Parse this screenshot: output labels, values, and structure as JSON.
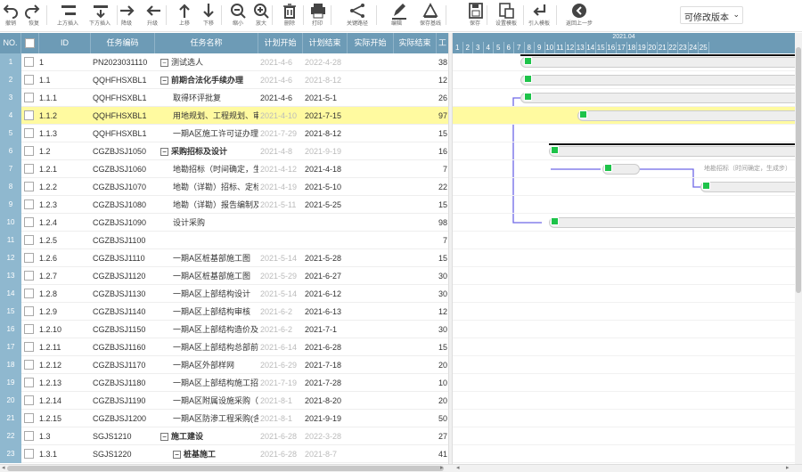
{
  "toolbar": {
    "items": [
      {
        "label": "撤销",
        "icon": "undo-icon"
      },
      {
        "label": "恢复",
        "icon": "redo-icon"
      },
      {
        "label": "上方插入",
        "icon": "insert-above-icon"
      },
      {
        "label": "下方插入",
        "icon": "insert-below-icon"
      },
      {
        "label": "降级",
        "icon": "demote-icon"
      },
      {
        "label": "升级",
        "icon": "promote-icon"
      },
      {
        "label": "上移",
        "icon": "move-up-icon"
      },
      {
        "label": "下移",
        "icon": "move-down-icon"
      },
      {
        "label": "缩小",
        "icon": "zoom-out-icon"
      },
      {
        "label": "放大",
        "icon": "zoom-in-icon"
      },
      {
        "label": "删除",
        "icon": "trash-icon"
      },
      {
        "label": "打印",
        "icon": "print-icon"
      },
      {
        "label": "关键路径",
        "icon": "critical-path-icon"
      },
      {
        "label": "编辑",
        "icon": "edit-icon"
      },
      {
        "label": "保存基线",
        "icon": "save-baseline-icon"
      },
      {
        "label": "保存",
        "icon": "save-icon"
      },
      {
        "label": "设置模板",
        "icon": "template-icon"
      },
      {
        "label": "引入模板",
        "icon": "import-icon"
      },
      {
        "label": "返回上一步",
        "icon": "back-icon"
      }
    ],
    "version_select": "可修改版本"
  },
  "grid": {
    "columns": {
      "no": "NO.",
      "id": "ID",
      "code": "任务编码",
      "name": "任务名称",
      "plan_start": "计划开始",
      "plan_end": "计划结束",
      "actual_start": "实际开始",
      "actual_end": "实际结束",
      "duration": "工"
    },
    "rows": [
      {
        "no": "1",
        "id": "1",
        "code": "PN2023031110",
        "name": "测试选人",
        "toggle": "−",
        "bold": false,
        "ps": "2021-4-6",
        "pe": "2022-4-28",
        "pe_grey": true,
        "ps_dark": false,
        "d": "38"
      },
      {
        "no": "2",
        "id": "1.1",
        "code": "QQHFHSXBL1",
        "name": "前期合法化手续办理",
        "toggle": "−",
        "bold": true,
        "ps": "2021-4-6",
        "pe": "2021-8-12",
        "pe_grey": true,
        "ps_dark": false,
        "d": "12"
      },
      {
        "no": "3",
        "id": "1.1.1",
        "code": "QQHFHSXBL1",
        "name": "取得环评批复",
        "toggle": "",
        "bold": false,
        "ps": "2021-4-6",
        "pe": "2021-5-1",
        "pe_grey": false,
        "ps_dark": true,
        "d": "26"
      },
      {
        "no": "4",
        "id": "1.1.2",
        "code": "QQHFHSXBL1",
        "name": "用地规划、工程规划、审",
        "toggle": "",
        "bold": false,
        "ps": "2021-4-10",
        "pe": "2021-7-15",
        "pe_grey": false,
        "ps_dark": false,
        "d": "97",
        "hl": true
      },
      {
        "no": "5",
        "id": "1.1.3",
        "code": "QQHFHSXBL1",
        "name": "一期A区施工许可证办理",
        "toggle": "",
        "bold": false,
        "ps": "2021-7-29",
        "pe": "2021-8-12",
        "pe_grey": false,
        "ps_dark": false,
        "d": "15"
      },
      {
        "no": "6",
        "id": "1.2",
        "code": "CGZBJSJ1050",
        "name": "采购招标及设计",
        "toggle": "−",
        "bold": true,
        "ps": "2021-4-8",
        "pe": "2021-9-19",
        "pe_grey": true,
        "ps_dark": false,
        "d": "16"
      },
      {
        "no": "7",
        "id": "1.2.1",
        "code": "CGZBJSJ1060",
        "name": "地勘招标（时间确定，生",
        "toggle": "",
        "bold": false,
        "ps": "2021-4-12",
        "pe": "2021-4-18",
        "pe_grey": false,
        "ps_dark": false,
        "d": "7"
      },
      {
        "no": "8",
        "id": "1.2.2",
        "code": "CGZBJSJ1070",
        "name": "地勘（详勘）招标、定标",
        "toggle": "",
        "bold": false,
        "ps": "2021-4-19",
        "pe": "2021-5-10",
        "pe_grey": false,
        "ps_dark": false,
        "d": "22"
      },
      {
        "no": "9",
        "id": "1.2.3",
        "code": "CGZBJSJ1080",
        "name": "地勘（详勘）报告编制及",
        "toggle": "",
        "bold": false,
        "ps": "2021-5-11",
        "pe": "2021-5-25",
        "pe_grey": false,
        "ps_dark": false,
        "d": "15"
      },
      {
        "no": "10",
        "id": "1.2.4",
        "code": "CGZBJSJ1090",
        "name": "设计采购",
        "toggle": "",
        "bold": false,
        "ps": "",
        "pe": "",
        "pe_grey": false,
        "ps_dark": false,
        "d": "98"
      },
      {
        "no": "11",
        "id": "1.2.5",
        "code": "CGZBJSJ1100",
        "name": "",
        "toggle": "",
        "bold": false,
        "ps": "",
        "pe": "",
        "pe_grey": false,
        "ps_dark": false,
        "d": "7"
      },
      {
        "no": "12",
        "id": "1.2.6",
        "code": "CGZBJSJ1110",
        "name": "一期A区桩基部施工图",
        "toggle": "",
        "bold": false,
        "ps": "2021-5-14",
        "pe": "2021-5-28",
        "pe_grey": false,
        "ps_dark": false,
        "d": "15"
      },
      {
        "no": "13",
        "id": "1.2.7",
        "code": "CGZBJSJ1120",
        "name": "一期A区桩基部施工图",
        "toggle": "",
        "bold": false,
        "ps": "2021-5-29",
        "pe": "2021-6-27",
        "pe_grey": false,
        "ps_dark": false,
        "d": "30"
      },
      {
        "no": "14",
        "id": "1.2.8",
        "code": "CGZBJSJ1130",
        "name": "一期A区上部结构设计",
        "toggle": "",
        "bold": false,
        "ps": "2021-5-14",
        "pe": "2021-6-12",
        "pe_grey": false,
        "ps_dark": false,
        "d": "30"
      },
      {
        "no": "15",
        "id": "1.2.9",
        "code": "CGZBJSJ1140",
        "name": "一期A区上部结构审核",
        "toggle": "",
        "bold": false,
        "ps": "2021-6-2",
        "pe": "2021-6-13",
        "pe_grey": false,
        "ps_dark": false,
        "d": "12"
      },
      {
        "no": "16",
        "id": "1.2.10",
        "code": "CGZBJSJ1150",
        "name": "一期A区上部结构造价及",
        "toggle": "",
        "bold": false,
        "ps": "2021-6-2",
        "pe": "2021-7-1",
        "pe_grey": false,
        "ps_dark": false,
        "d": "30"
      },
      {
        "no": "17",
        "id": "1.2.11",
        "code": "CGZBJSJ1160",
        "name": "一期A区上部结构总部前",
        "toggle": "",
        "bold": false,
        "ps": "2021-6-14",
        "pe": "2021-6-28",
        "pe_grey": false,
        "ps_dark": false,
        "d": "15"
      },
      {
        "no": "18",
        "id": "1.2.12",
        "code": "CGZBJSJ1170",
        "name": "一期A区外部样网",
        "toggle": "",
        "bold": false,
        "ps": "2021-6-29",
        "pe": "2021-7-18",
        "pe_grey": false,
        "ps_dark": false,
        "d": "20"
      },
      {
        "no": "19",
        "id": "1.2.13",
        "code": "CGZBJSJ1180",
        "name": "一期A区上部结构施工招",
        "toggle": "",
        "bold": false,
        "ps": "2021-7-19",
        "pe": "2021-7-28",
        "pe_grey": false,
        "ps_dark": false,
        "d": "10"
      },
      {
        "no": "20",
        "id": "1.2.14",
        "code": "CGZBJSJ1190",
        "name": "一期A区附属设施采购（",
        "toggle": "",
        "bold": false,
        "ps": "2021-8-1",
        "pe": "2021-8-20",
        "pe_grey": false,
        "ps_dark": false,
        "d": "20"
      },
      {
        "no": "21",
        "id": "1.2.15",
        "code": "CGZBJSJ1200",
        "name": "一期A区防渗工程采购(含",
        "toggle": "",
        "bold": false,
        "ps": "2021-8-1",
        "pe": "2021-9-19",
        "pe_grey": false,
        "ps_dark": false,
        "d": "50"
      },
      {
        "no": "22",
        "id": "1.3",
        "code": "SGJS1210",
        "name": "施工建设",
        "toggle": "−",
        "bold": true,
        "ps": "2021-6-28",
        "pe": "2022-3-28",
        "pe_grey": true,
        "ps_dark": false,
        "d": "27"
      },
      {
        "no": "23",
        "id": "1.3.1",
        "code": "SGJS1220",
        "name": "桩基施工",
        "toggle": "−",
        "bold": true,
        "ps": "2021-6-28",
        "pe": "2021-8-7",
        "pe_grey": true,
        "ps_dark": false,
        "d": "41"
      }
    ]
  },
  "gantt": {
    "month": "2021.04",
    "days": [
      "1",
      "2",
      "3",
      "4",
      "5",
      "6",
      "7",
      "8",
      "9",
      "10",
      "11",
      "12",
      "13",
      "14",
      "15",
      "16",
      "17",
      "18",
      "19",
      "20",
      "21",
      "22",
      "23",
      "24",
      "25"
    ],
    "label_row7": "地勘招标（时间确定，生成步）"
  },
  "colors": {
    "header": "#6d9bb6",
    "marker": "#1ec34a",
    "highlight": "#fffaa0",
    "link": "#6e67e6"
  }
}
